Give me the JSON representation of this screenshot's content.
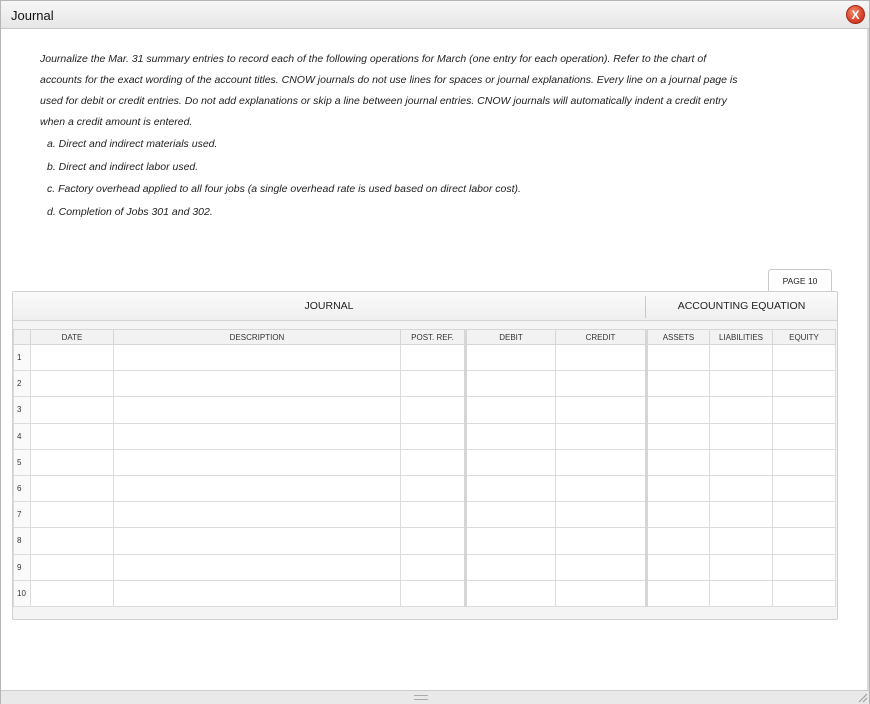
{
  "window": {
    "title": "Journal",
    "close_label": "X",
    "accent_close": "#d8432a"
  },
  "instructions": {
    "intro": "Journalize the Mar. 31 summary entries to record each of the following operations for March (one entry for each operation). Refer to the chart of accounts for the exact wording of the account titles. CNOW journals do not use lines for spaces or journal explanations. Every line on a journal page is used for debit or credit entries. Do not add explanations or skip a line between journal entries. CNOW journals will automatically indent a credit entry when a credit amount is entered.",
    "items": [
      "a. Direct and indirect materials used.",
      "b. Direct and indirect labor used.",
      "c. Factory overhead applied to all four jobs (a single overhead rate is used based on direct labor cost).",
      "d. Completion of Jobs 301 and 302."
    ]
  },
  "journal": {
    "page_tab": "PAGE 10",
    "section_journal": "JOURNAL",
    "section_accounting": "ACCOUNTING EQUATION",
    "columns": [
      "DATE",
      "DESCRIPTION",
      "POST. REF.",
      "DEBIT",
      "CREDIT",
      "ASSETS",
      "LIABILITIES",
      "EQUITY"
    ],
    "rows": [
      "1",
      "2",
      "3",
      "4",
      "5",
      "6",
      "7",
      "8",
      "9",
      "10"
    ]
  }
}
